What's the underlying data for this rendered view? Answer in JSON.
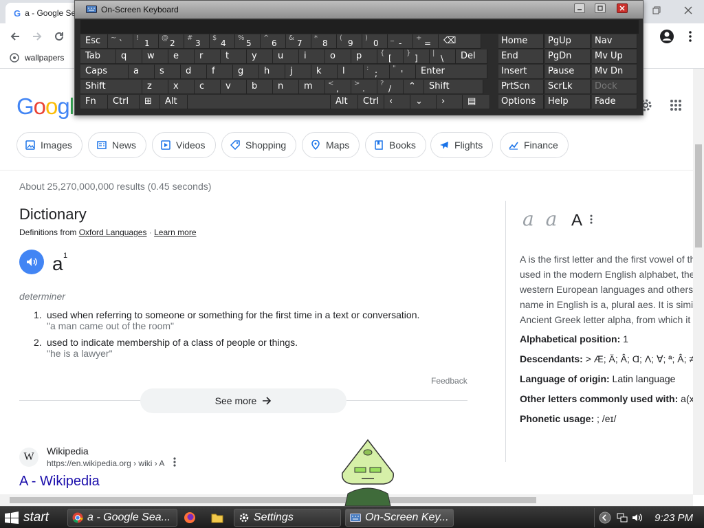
{
  "browser": {
    "tab_title": "a - Google Search",
    "bookmark_label": "wallpapers"
  },
  "google": {
    "logo_text": "Google",
    "chips": [
      "Images",
      "News",
      "Videos",
      "Shopping",
      "Maps",
      "Books",
      "Flights",
      "Finance"
    ],
    "result_stats": "About 25,270,000,000 results (0.45 seconds)"
  },
  "dictionary": {
    "title": "Dictionary",
    "source_prefix": "Definitions from ",
    "source_name": "Oxford Languages",
    "source_sep": " · ",
    "learn_more": "Learn more",
    "word": "a",
    "superscript": "1",
    "part_of_speech": "determiner",
    "definitions": [
      {
        "num": "1.",
        "text": "used when referring to someone or something for the first time in a text or conversation.",
        "example": "\"a man came out of the room\""
      },
      {
        "num": "2.",
        "text": "used to indicate membership of a class of people or things.",
        "example": "\"he is a lawyer\""
      }
    ],
    "feedback": "Feedback",
    "see_more": "See more"
  },
  "wikipedia_result": {
    "favicon": "W",
    "site_name": "Wikipedia",
    "url": "https://en.wikipedia.org › wiki › A",
    "title": "A - Wikipedia"
  },
  "knowledge_panel": {
    "script_letters": "a a",
    "letter": "A",
    "description_lines": [
      "A is the first letter and the first vowel of th",
      "used in the modern English alphabet, the",
      "western European languages and others",
      "name in English is a, plural aes. It is simi",
      "Ancient Greek letter alpha, from which it"
    ],
    "facts": [
      {
        "label": "Alphabetical position:",
        "value": " 1"
      },
      {
        "label": "Descendants:",
        "value": " > Æ; Ä; Â; Ɑ; Ʌ; ∀; ª; Â; ≠"
      },
      {
        "label": "Language of origin:",
        "value": " Latin language"
      },
      {
        "label": "Other letters commonly used with:",
        "value": " a(x"
      },
      {
        "label": "Phonetic usage:",
        "value": " ; /eɪ/"
      }
    ]
  },
  "osk": {
    "title": "On-Screen Keyboard",
    "rows": [
      [
        {
          "l": "Esc",
          "w": 40
        },
        {
          "s": "~",
          "m": "`",
          "w": 37
        },
        {
          "s": "!",
          "m": "1",
          "w": 37
        },
        {
          "s": "@",
          "m": "2",
          "w": 37
        },
        {
          "s": "#",
          "m": "3",
          "w": 37
        },
        {
          "s": "$",
          "m": "4",
          "w": 37
        },
        {
          "s": "%",
          "m": "5",
          "w": 37
        },
        {
          "s": "^",
          "m": "6",
          "w": 37
        },
        {
          "s": "&",
          "m": "7",
          "w": 37
        },
        {
          "s": "*",
          "m": "8",
          "w": 37
        },
        {
          "s": "(",
          "m": "9",
          "w": 37
        },
        {
          "s": ")",
          "m": "0",
          "w": 37
        },
        {
          "s": "_",
          "m": "-",
          "w": 37
        },
        {
          "s": "+",
          "m": "=",
          "w": 37
        },
        {
          "l": "⌫",
          "w": 62
        }
      ],
      [
        {
          "l": "Tab",
          "w": 52
        },
        {
          "l": "q",
          "w": 38
        },
        {
          "l": "w",
          "w": 38
        },
        {
          "l": "e",
          "w": 38
        },
        {
          "l": "r",
          "w": 38
        },
        {
          "l": "t",
          "w": 38
        },
        {
          "l": "y",
          "w": 38
        },
        {
          "l": "u",
          "w": 38
        },
        {
          "l": "i",
          "w": 38
        },
        {
          "l": "o",
          "w": 38
        },
        {
          "l": "p",
          "w": 38
        },
        {
          "s": "{",
          "m": "[",
          "w": 38
        },
        {
          "s": "}",
          "m": "]",
          "w": 38
        },
        {
          "s": "|",
          "m": "\\",
          "w": 38
        },
        {
          "l": "Del",
          "w": 46
        }
      ],
      [
        {
          "l": "Caps",
          "w": 70
        },
        {
          "l": "a",
          "w": 38
        },
        {
          "l": "s",
          "w": 38
        },
        {
          "l": "d",
          "w": 38
        },
        {
          "l": "f",
          "w": 38
        },
        {
          "l": "g",
          "w": 38
        },
        {
          "l": "h",
          "w": 38
        },
        {
          "l": "j",
          "w": 38
        },
        {
          "l": "k",
          "w": 38
        },
        {
          "l": "l",
          "w": 38
        },
        {
          "s": ":",
          "m": ";",
          "w": 38
        },
        {
          "s": "\"",
          "m": "'",
          "w": 38
        },
        {
          "l": "Enter",
          "w": 104
        }
      ],
      [
        {
          "l": "Shift",
          "w": 90
        },
        {
          "l": "z",
          "w": 38
        },
        {
          "l": "x",
          "w": 38
        },
        {
          "l": "c",
          "w": 38
        },
        {
          "l": "v",
          "w": 38
        },
        {
          "l": "b",
          "w": 38
        },
        {
          "l": "n",
          "w": 38
        },
        {
          "l": "m",
          "w": 38
        },
        {
          "s": "<",
          "m": ",",
          "w": 38
        },
        {
          "s": ">",
          "m": ".",
          "w": 38
        },
        {
          "s": "?",
          "m": "/",
          "w": 38
        },
        {
          "l": "⌃",
          "w": 30
        },
        {
          "l": "Shift",
          "w": 86
        }
      ],
      [
        {
          "l": "Fn",
          "w": 40
        },
        {
          "l": "Ctrl",
          "w": 46
        },
        {
          "l": "⊞",
          "w": 30
        },
        {
          "l": "Alt",
          "w": 40
        },
        {
          "l": "",
          "w": 208
        },
        {
          "l": "Alt",
          "w": 40
        },
        {
          "l": "Ctrl",
          "w": 38
        },
        {
          "l": "‹",
          "w": 38
        },
        {
          "l": "⌄",
          "w": 38
        },
        {
          "l": "›",
          "w": 38
        },
        {
          "l": "▤",
          "w": 40
        }
      ]
    ],
    "nav_rows": [
      [
        {
          "l": "Home"
        },
        {
          "l": "PgUp"
        },
        {
          "l": "Nav"
        }
      ],
      [
        {
          "l": "End"
        },
        {
          "l": "PgDn"
        },
        {
          "l": "Mv Up"
        }
      ],
      [
        {
          "l": "Insert"
        },
        {
          "l": "Pause"
        },
        {
          "l": "Mv Dn"
        }
      ],
      [
        {
          "l": "PrtScn"
        },
        {
          "l": "ScrLk"
        },
        {
          "l": "Dock",
          "dim": true
        }
      ],
      [
        {
          "l": "Options"
        },
        {
          "l": "Help"
        },
        {
          "l": "Fade"
        }
      ]
    ]
  },
  "taskbar": {
    "start_label": "start",
    "tasks": [
      "a - Google Sea...",
      "Settings",
      "On-Screen Key..."
    ],
    "clock": "9:23 PM"
  },
  "colors": {
    "google_blue": "#4285f4",
    "link_blue": "#1a0dab",
    "osk_key": "#3d3d3d"
  }
}
